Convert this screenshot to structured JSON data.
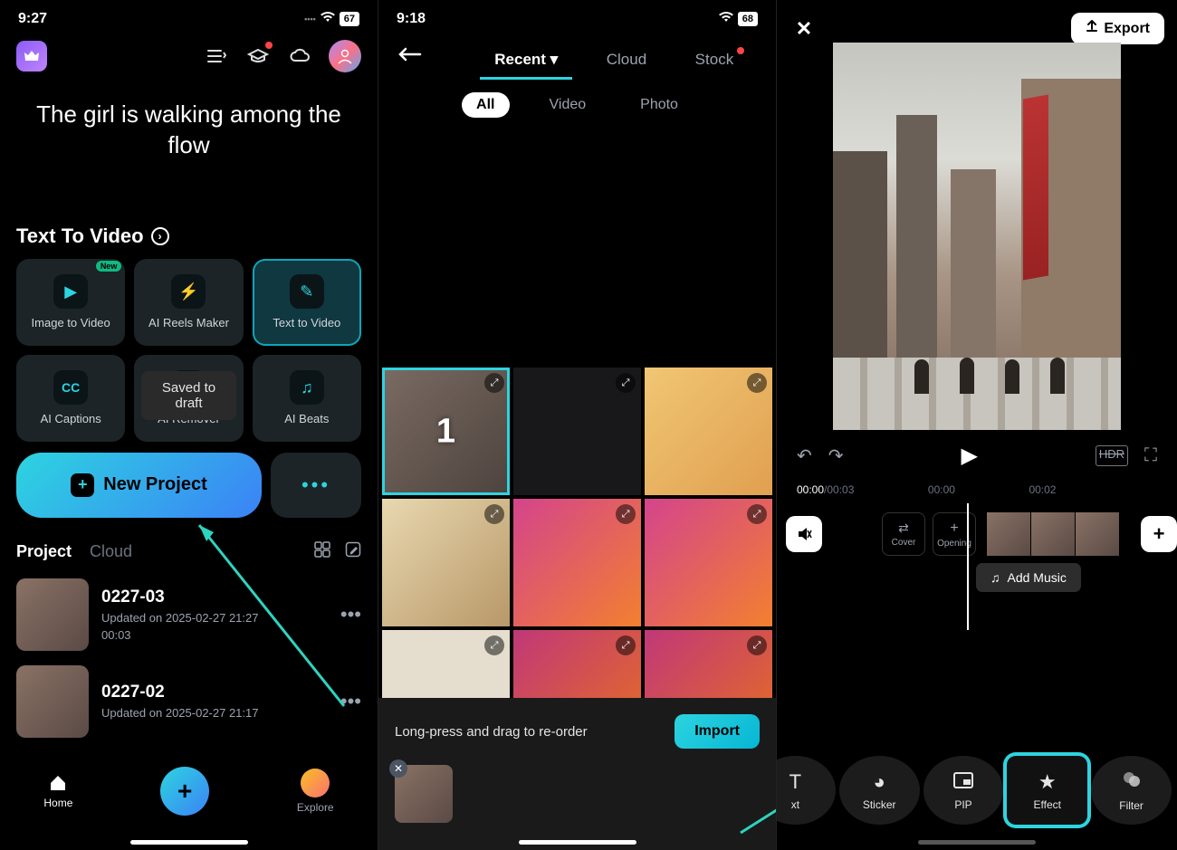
{
  "panel1": {
    "status": {
      "time": "9:27",
      "battery": "67"
    },
    "hero": "The girl is walking among the flow",
    "section": "Text To Video",
    "features": [
      {
        "label": "Image to Video",
        "badge": "New"
      },
      {
        "label": "AI Reels Maker"
      },
      {
        "label": "Text  to Video",
        "active": true
      },
      {
        "label": "AI Captions"
      },
      {
        "label": "AI Remover"
      },
      {
        "label": "AI Beats"
      }
    ],
    "toast": "Saved to draft",
    "newProject": "New Project",
    "tabs": {
      "primary": "Project",
      "secondary": "Cloud"
    },
    "projects": [
      {
        "title": "0227-03",
        "updated": "Updated on 2025-02-27 21:27",
        "dur": "00:03"
      },
      {
        "title": "0227-02",
        "updated": "Updated on 2025-02-27 21:17"
      }
    ],
    "nav": {
      "home": "Home",
      "explore": "Explore"
    }
  },
  "panel2": {
    "status": {
      "time": "9:18",
      "battery": "68"
    },
    "srcTabs": [
      "Recent",
      "Cloud",
      "Stock"
    ],
    "filters": [
      "All",
      "Video",
      "Photo"
    ],
    "selectedNum": "1",
    "hint": "Long-press and drag to re-order",
    "import": "Import"
  },
  "panel3": {
    "export": "Export",
    "time": {
      "cur": "00:00",
      "total": "/00:03",
      "m1": "00:00",
      "m2": "00:02"
    },
    "mini": {
      "cover": "Cover",
      "opening": "Opening"
    },
    "music": "Add Music",
    "tools": [
      "xt",
      "Sticker",
      "PIP",
      "Effect",
      "Filter"
    ]
  }
}
